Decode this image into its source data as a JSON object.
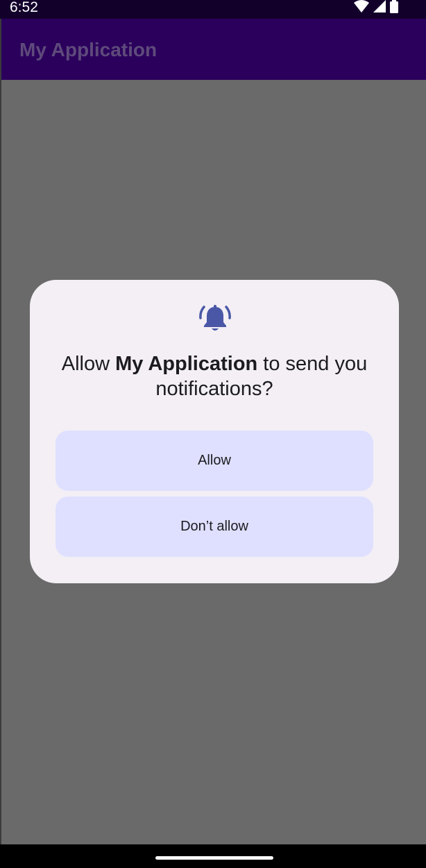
{
  "status_bar": {
    "time": "6:52",
    "icons": [
      "wifi-icon",
      "signal-icon",
      "battery-icon"
    ]
  },
  "app_bar": {
    "title": "My Application"
  },
  "dialog": {
    "icon": "bell-ringing-icon",
    "title_prefix": "Allow ",
    "title_app": "My Application",
    "title_suffix": " to send you notifications?",
    "allow_label": "Allow",
    "deny_label": "Don’t allow"
  },
  "colors": {
    "status_bar": "#12002b",
    "app_bar": "#2b005d",
    "scrim": "#6a6a6a",
    "dialog_bg": "#f3eff5",
    "button_bg": "#dfe0ff",
    "icon_accent": "#4a57a6"
  }
}
